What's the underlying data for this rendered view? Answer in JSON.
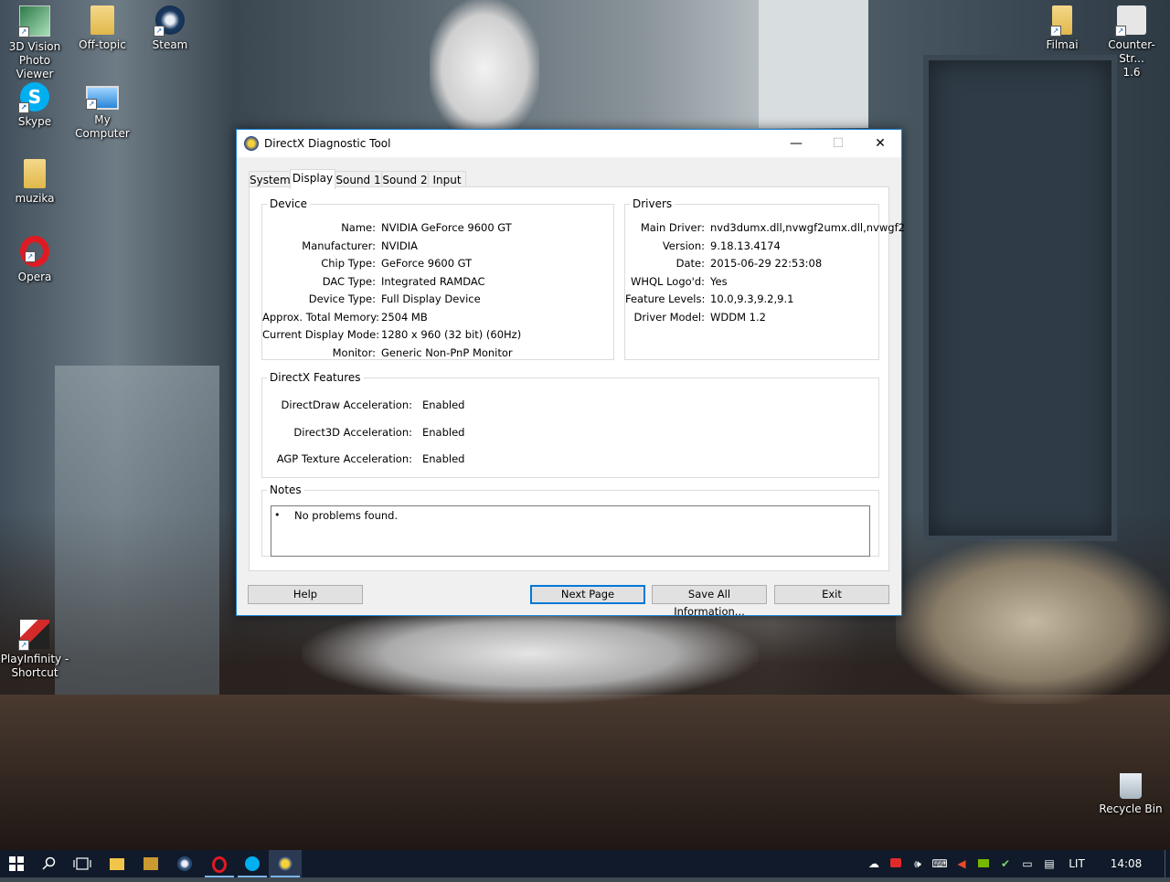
{
  "desktop": {
    "icons_left": [
      {
        "label": "3D Vision\nPhoto Viewer",
        "l1": "3D Vision",
        "l2": "Photo Viewer",
        "icon": "3d-vision-icon"
      },
      {
        "label": "Off-topic",
        "icon": "folder-icon"
      },
      {
        "label": "Steam",
        "icon": "steam-icon"
      },
      {
        "label": "Skype",
        "icon": "skype-icon"
      },
      {
        "l1": "My",
        "l2": "Computer",
        "icon": "computer-icon"
      },
      {
        "label": "muzika",
        "icon": "folder-icon"
      },
      {
        "label": "Opera",
        "icon": "opera-icon"
      },
      {
        "l1": "PlayInfinity -",
        "l2": "Shortcut",
        "icon": "playinfinity-icon"
      }
    ],
    "filmai": "Filmai",
    "counter_strike_l1": "Counter-Str...",
    "counter_strike_l2": "1.6",
    "recycle_bin": "Recycle Bin"
  },
  "window": {
    "title": "DirectX Diagnostic Tool",
    "tabs": [
      "System",
      "Display",
      "Sound 1",
      "Sound 2",
      "Input"
    ],
    "active_tab": "Display",
    "device": {
      "legend": "Device",
      "rows": [
        {
          "label": "Name:",
          "value": "NVIDIA GeForce 9600 GT"
        },
        {
          "label": "Manufacturer:",
          "value": "NVIDIA"
        },
        {
          "label": "Chip Type:",
          "value": "GeForce 9600 GT"
        },
        {
          "label": "DAC Type:",
          "value": "Integrated RAMDAC"
        },
        {
          "label": "Device Type:",
          "value": "Full Display Device"
        },
        {
          "label": "Approx. Total Memory:",
          "value": "2504 MB"
        },
        {
          "label": "Current Display Mode:",
          "value": "1280 x 960 (32 bit) (60Hz)"
        },
        {
          "label": "Monitor:",
          "value": "Generic Non-PnP Monitor"
        }
      ]
    },
    "drivers": {
      "legend": "Drivers",
      "rows": [
        {
          "label": "Main Driver:",
          "value": "nvd3dumx.dll,nvwgf2umx.dll,nvwgf2"
        },
        {
          "label": "Version:",
          "value": "9.18.13.4174"
        },
        {
          "label": "Date:",
          "value": "2015-06-29 22:53:08"
        },
        {
          "label": "WHQL Logo'd:",
          "value": "Yes"
        },
        {
          "label": "Feature Levels:",
          "value": "10.0,9.3,9.2,9.1"
        },
        {
          "label": "Driver Model:",
          "value": "WDDM 1.2"
        }
      ]
    },
    "features": {
      "legend": "DirectX Features",
      "rows": [
        {
          "label": "DirectDraw Acceleration:",
          "value": "Enabled"
        },
        {
          "label": "Direct3D Acceleration:",
          "value": "Enabled"
        },
        {
          "label": "AGP Texture Acceleration:",
          "value": "Enabled"
        }
      ]
    },
    "notes": {
      "legend": "Notes",
      "bullet": "•",
      "text": "No problems found."
    },
    "buttons": {
      "help": "Help",
      "next_page": "Next Page",
      "save_all": "Save All Information...",
      "exit": "Exit"
    },
    "controls": {
      "minimize": "—",
      "maximize": "☐",
      "close": "✕"
    }
  },
  "taskbar": {
    "language": "LIT",
    "time": "14:08"
  }
}
